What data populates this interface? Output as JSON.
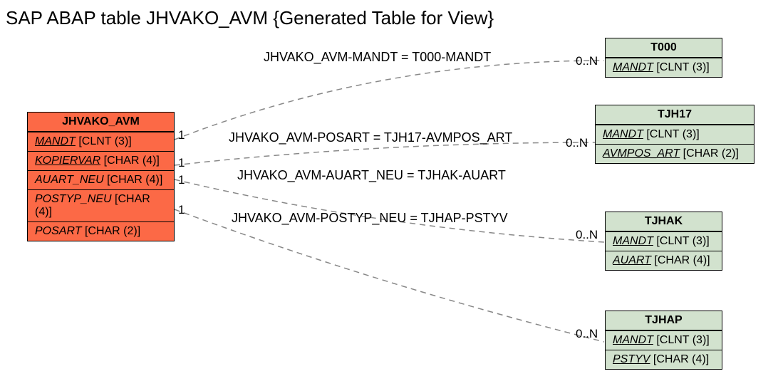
{
  "title": "SAP ABAP table JHVAKO_AVM {Generated Table for View}",
  "main": {
    "name": "JHVAKO_AVM",
    "fields": [
      {
        "label": "MANDT",
        "type": "[CLNT (3)]",
        "key": true
      },
      {
        "label": "KOPIERVAR",
        "type": "[CHAR (4)]",
        "key": true
      },
      {
        "label": "AUART_NEU",
        "type": "[CHAR (4)]",
        "key": false
      },
      {
        "label": "POSTYP_NEU",
        "type": "[CHAR (4)]",
        "key": false
      },
      {
        "label": "POSART",
        "type": "[CHAR (2)]",
        "key": false
      }
    ]
  },
  "refs": {
    "t000": {
      "name": "T000",
      "fields": [
        {
          "label": "MANDT",
          "type": "[CLNT (3)]",
          "key": true
        }
      ]
    },
    "tjh17": {
      "name": "TJH17",
      "fields": [
        {
          "label": "MANDT",
          "type": "[CLNT (3)]",
          "key": true
        },
        {
          "label": "AVMPOS_ART",
          "type": "[CHAR (2)]",
          "key": true
        }
      ]
    },
    "tjhak": {
      "name": "TJHAK",
      "fields": [
        {
          "label": "MANDT",
          "type": "[CLNT (3)]",
          "key": true
        },
        {
          "label": "AUART",
          "type": "[CHAR (4)]",
          "key": true
        }
      ]
    },
    "tjhap": {
      "name": "TJHAP",
      "fields": [
        {
          "label": "MANDT",
          "type": "[CLNT (3)]",
          "key": true
        },
        {
          "label": "PSTYV",
          "type": "[CHAR (4)]",
          "key": true
        }
      ]
    }
  },
  "relations": {
    "r1": {
      "label": "JHVAKO_AVM-MANDT = T000-MANDT",
      "leftCard": "1",
      "rightCard": "0..N"
    },
    "r2": {
      "label": "JHVAKO_AVM-POSART = TJH17-AVMPOS_ART",
      "leftCard": "1",
      "rightCard": "0..N"
    },
    "r3": {
      "label": "JHVAKO_AVM-AUART_NEU = TJHAK-AUART",
      "leftCard": "1",
      "rightCard": "0..N"
    },
    "r4": {
      "label": "JHVAKO_AVM-POSTYP_NEU = TJHAP-PSTYV",
      "leftCard": "1",
      "rightCard": "0..N"
    }
  }
}
